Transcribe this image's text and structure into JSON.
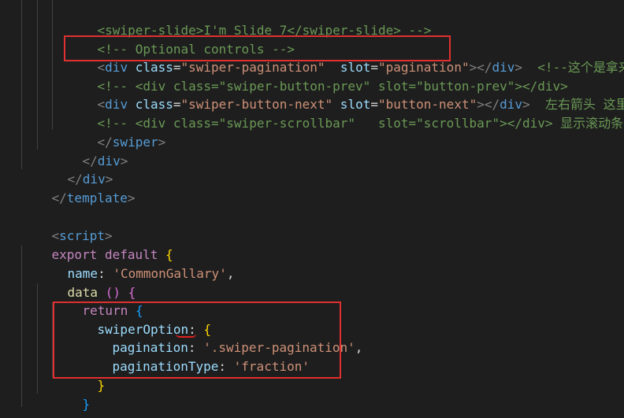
{
  "code": {
    "l1": {
      "indent": "    ",
      "a": "<swiper-slide>I'm Slide 7</swiper-slide> -->"
    },
    "l2": {
      "indent": "    ",
      "a": "<!-- Optional controls -->"
    },
    "l3": {
      "indent": "    ",
      "open": "<",
      "tag": "div",
      "attr1": " class",
      "eq1": "=",
      "val1": "\"swiper-pagination\"",
      "attr2": "  slot",
      "eq2": "=",
      "val2": "\"pagination\"",
      "close": "></",
      "ctag": "div",
      "end": ">",
      "cmt": "  <!--这个是拿来做拒"
    },
    "l4": {
      "indent": "    ",
      "a": "<!-- <div class=\"swiper-button-prev\" slot=\"button-prev\"></div>"
    },
    "l5": {
      "indent": "    ",
      "open": "<",
      "tag": "div",
      "attr1": " class",
      "eq1": "=",
      "val1": "\"swiper-button-next\"",
      "attr2": " slot",
      "eq2": "=",
      "val2": "\"button-next\"",
      "close": "></",
      "ctag": "div",
      "end": ">",
      "cmt": "  左右箭头 这里不需"
    },
    "l6": {
      "indent": "    ",
      "a": "<!-- <div class=\"swiper-scrollbar\"   slot=\"scrollbar\"></div> 显示滚动条的 这"
    },
    "l7": {
      "indent": "    ",
      "open": "</",
      "tag": "swiper",
      "end": ">"
    },
    "l8": {
      "indent": "  ",
      "open": "</",
      "tag": "div",
      "end": ">"
    },
    "l9": {
      "indent": " ",
      "open": "</",
      "tag": "div",
      "end": ">"
    },
    "l10": {
      "open": "</",
      "tag": "template",
      "end": ">"
    },
    "l12": {
      "open": "<",
      "tag": "script",
      "end": ">"
    },
    "l13": {
      "kw": "export",
      "kw2": " default",
      "brace": " {"
    },
    "l14": {
      "prop": "name",
      "colon": ": ",
      "str": "'CommonGallary'",
      "comma": ","
    },
    "l15": {
      "fn": "data",
      "paren": " ()",
      "brace": " {"
    },
    "l16": {
      "kw": "return",
      "brace": " {"
    },
    "l17": {
      "prop": "swiperOption",
      "colon": ": ",
      "brace": "{"
    },
    "l18": {
      "prop": "pagination",
      "colon": ": ",
      "str": "'.swiper-pagination'",
      "comma": ","
    },
    "l19": {
      "prop": "paginationType",
      "colon": ": ",
      "str": "'fraction'"
    },
    "l20": {
      "brace": "}"
    },
    "l21": {
      "brace": "}"
    },
    "l22": {
      "brace": "}"
    }
  },
  "colors": {
    "background": "#1e1e1e",
    "highlight_box": "#e03030",
    "tag": "#569cd6",
    "attribute": "#9cdcfe",
    "string": "#ce9178",
    "comment": "#6a9955",
    "keyword": "#c586c0"
  }
}
